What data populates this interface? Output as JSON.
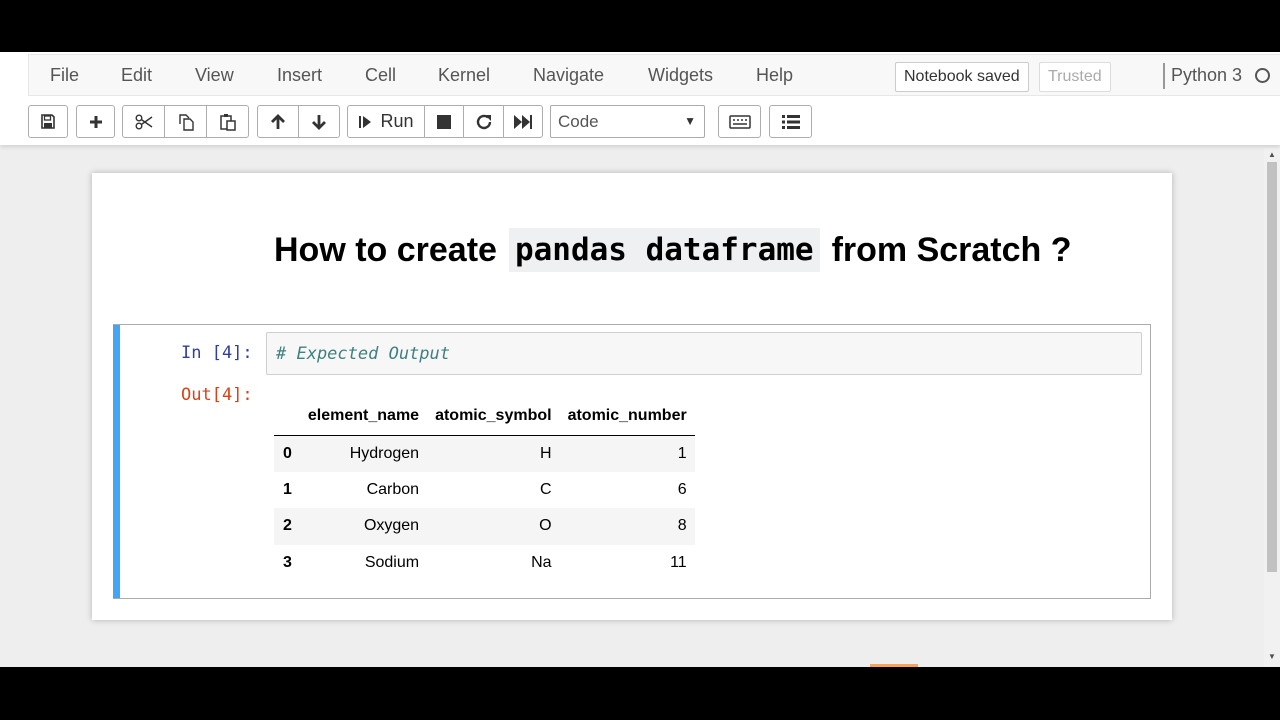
{
  "menu": {
    "items": [
      "File",
      "Edit",
      "View",
      "Insert",
      "Cell",
      "Kernel",
      "Navigate",
      "Widgets",
      "Help"
    ],
    "notebook_status": "Notebook saved",
    "trusted": "Trusted",
    "kernel": "Python 3"
  },
  "toolbar": {
    "run_label": "Run",
    "cell_type": "Code",
    "icons": [
      "save-icon",
      "plus-icon",
      "scissors-icon",
      "copy-icon",
      "paste-icon",
      "arrow-up-icon",
      "arrow-down-icon",
      "run-icon",
      "stop-icon",
      "restart-icon",
      "fast-forward-icon",
      "keyboard-icon",
      "list-icon"
    ]
  },
  "notebook": {
    "title_before": "How to create",
    "title_code": "pandas dataframe",
    "title_after": "from Scratch ?",
    "cell": {
      "in_prompt": "In [4]:",
      "code": "# Expected Output",
      "out_prompt": "Out[4]:"
    },
    "dataframe": {
      "columns": [
        "element_name",
        "atomic_symbol",
        "atomic_number"
      ],
      "rows": [
        {
          "index": "0",
          "values": [
            "Hydrogen",
            "H",
            "1"
          ]
        },
        {
          "index": "1",
          "values": [
            "Carbon",
            "C",
            "6"
          ]
        },
        {
          "index": "2",
          "values": [
            "Oxygen",
            "O",
            "8"
          ]
        },
        {
          "index": "3",
          "values": [
            "Sodium",
            "Na",
            "11"
          ]
        }
      ]
    }
  },
  "colors": {
    "selected_cell_bar": "#42a5f5",
    "in_prompt": "#303f9f",
    "out_prompt": "#d84315",
    "comment": "#408080"
  }
}
